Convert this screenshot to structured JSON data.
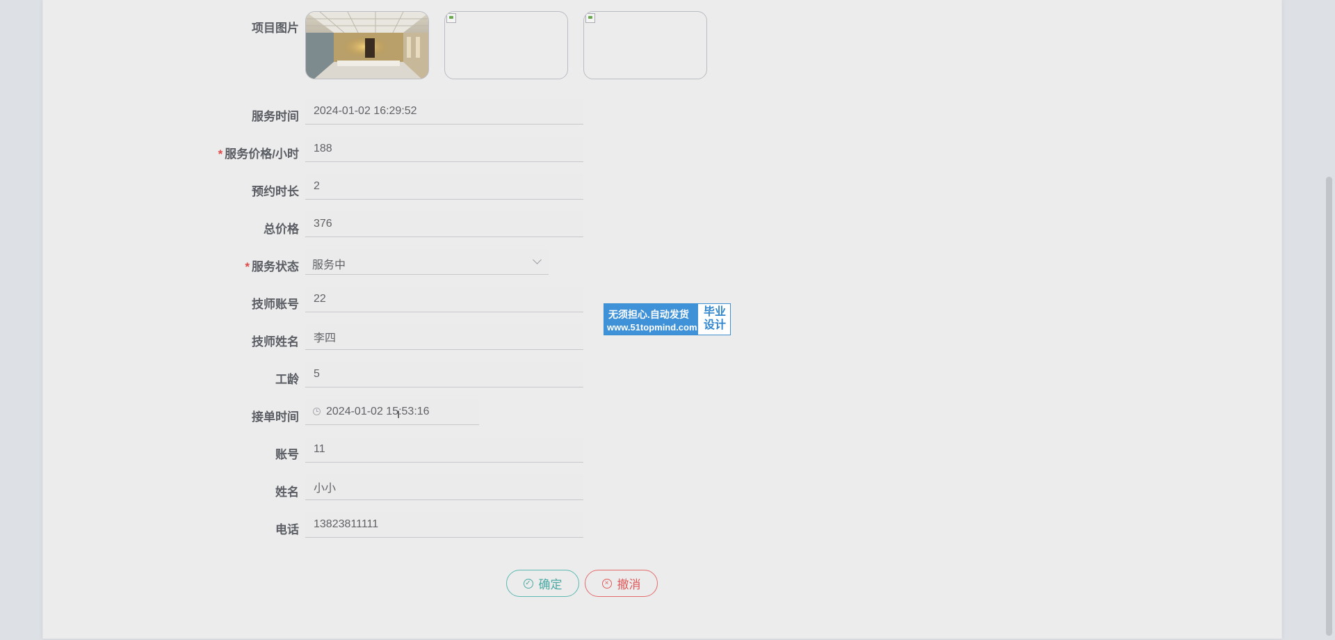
{
  "form": {
    "images": {
      "label": "项目图片",
      "items": [
        {
          "state": "loaded",
          "description": "photo"
        },
        {
          "state": "broken"
        },
        {
          "state": "broken"
        }
      ]
    },
    "service_time": {
      "label": "服务时间",
      "value": "2024-01-02 16:29:52"
    },
    "price_per_hour": {
      "label": "服务价格/小时",
      "required": true,
      "value": "188"
    },
    "duration": {
      "label": "预约时长",
      "value": "2"
    },
    "total_price": {
      "label": "总价格",
      "value": "376"
    },
    "service_status": {
      "label": "服务状态",
      "required": true,
      "value": "服务中"
    },
    "tech_account": {
      "label": "技师账号",
      "value": "22"
    },
    "tech_name": {
      "label": "技师姓名",
      "value": "李四"
    },
    "work_years": {
      "label": "工龄",
      "value": "5"
    },
    "order_time": {
      "label": "接单时间",
      "value": "2024-01-02 15:53:16"
    },
    "account": {
      "label": "账号",
      "value": "11"
    },
    "name": {
      "label": "姓名",
      "value": "小小"
    },
    "phone": {
      "label": "电话",
      "value": "13823811111"
    },
    "required_mark": "*"
  },
  "buttons": {
    "confirm": "确定",
    "cancel": "撤消"
  },
  "watermark": {
    "line1": "无须担心.自动发货",
    "line2": "www.51topmind.com",
    "right1": "毕业",
    "right2": "设计"
  },
  "colors": {
    "confirm": "#4aa9a2",
    "cancel": "#e05a5a",
    "required": "#e04848",
    "watermark": "#3f92d8"
  },
  "icons": {
    "confirm": "check-circle-icon",
    "cancel": "close-circle-icon",
    "order_time": "clock-icon",
    "status": "chevron-down-icon"
  }
}
